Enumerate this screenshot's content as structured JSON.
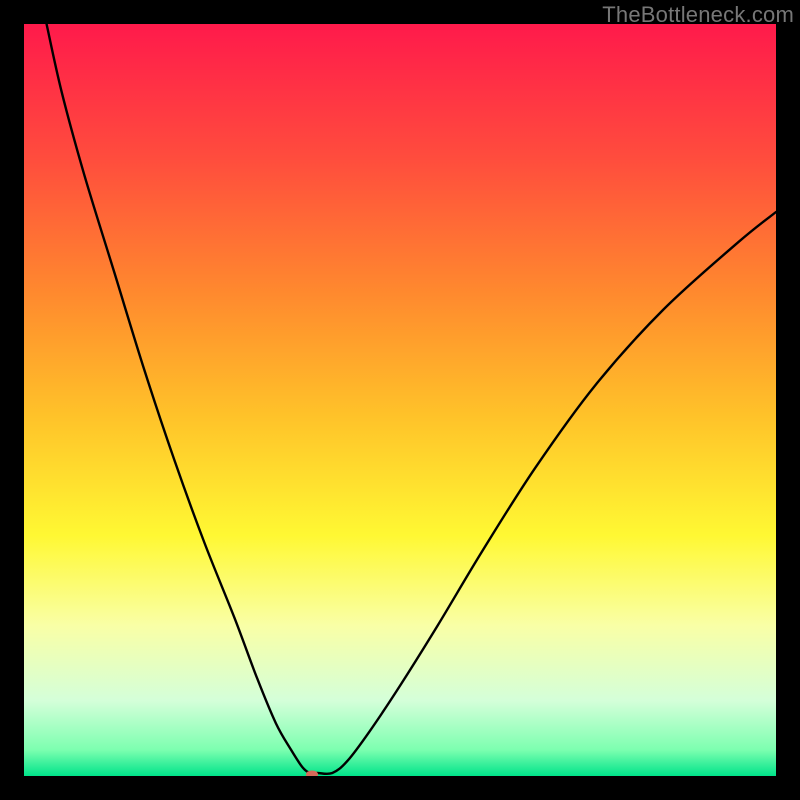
{
  "watermark": "TheBottleneck.com",
  "chart_data": {
    "type": "line",
    "title": "",
    "xlabel": "",
    "ylabel": "",
    "xlim": [
      0,
      100
    ],
    "ylim": [
      0,
      100
    ],
    "grid": false,
    "legend": false,
    "background_gradient": {
      "stops": [
        {
          "pos": 0.0,
          "color": "#ff1a4b"
        },
        {
          "pos": 0.18,
          "color": "#ff4d3d"
        },
        {
          "pos": 0.36,
          "color": "#ff8a2e"
        },
        {
          "pos": 0.52,
          "color": "#ffc229"
        },
        {
          "pos": 0.68,
          "color": "#fff833"
        },
        {
          "pos": 0.8,
          "color": "#f9ffa6"
        },
        {
          "pos": 0.9,
          "color": "#d4ffd9"
        },
        {
          "pos": 0.965,
          "color": "#7dffb0"
        },
        {
          "pos": 1.0,
          "color": "#00e38a"
        }
      ]
    },
    "series": [
      {
        "name": "bottleneck-curve",
        "color": "#000000",
        "x": [
          3,
          5,
          8,
          12,
          16,
          20,
          24,
          28,
          31,
          33.5,
          35.5,
          37,
          38,
          39,
          41,
          43,
          46,
          50,
          55,
          61,
          68,
          76,
          85,
          95,
          100
        ],
        "y": [
          100,
          91,
          80,
          67,
          54,
          42,
          31,
          21,
          13,
          7,
          3.5,
          1.2,
          0.4,
          0.4,
          0.4,
          2,
          6,
          12,
          20,
          30,
          41,
          52,
          62,
          71,
          75
        ]
      }
    ],
    "marker": {
      "x": 38.3,
      "y": 0.2,
      "color": "#d66a5a",
      "rx": 6,
      "ry": 4
    }
  }
}
